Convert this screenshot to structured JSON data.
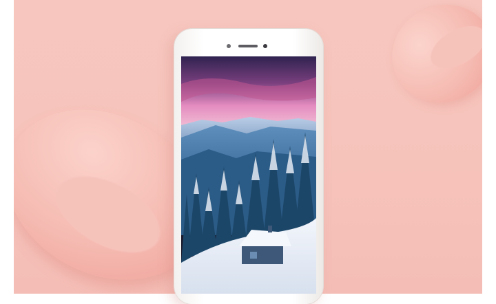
{
  "colors": {
    "background": "#f6c3bb",
    "phone_body": "#ffffff",
    "sky_top": "#3a2a5c",
    "sky_pink": "#e58bc0",
    "snow": "#e9eef6",
    "forest": "#1d4a6b"
  },
  "icons": {
    "front_camera": "camera-dot",
    "earpiece": "speaker-slot",
    "sensor": "sensor-dot"
  }
}
